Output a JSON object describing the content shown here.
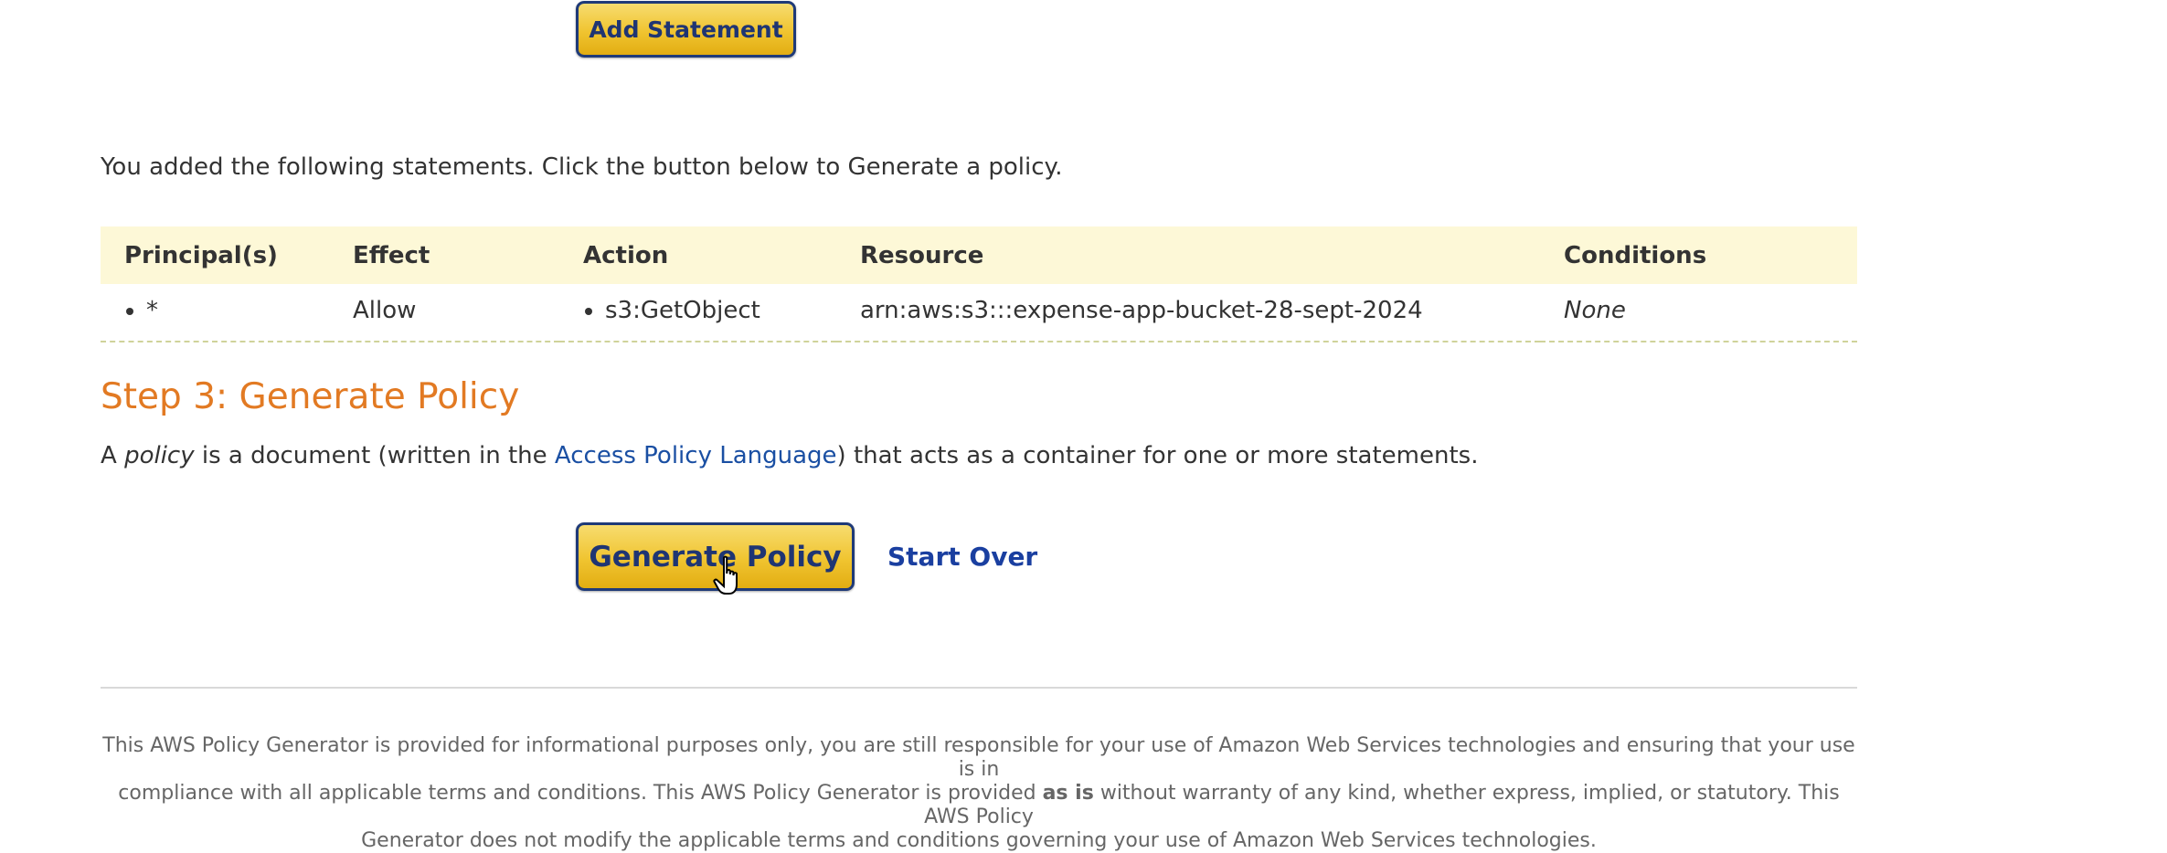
{
  "add_statement_button": "Add Statement",
  "intro_text": "You added the following statements. Click the button below to Generate a policy.",
  "statements_table": {
    "headers": [
      "Principal(s)",
      "Effect",
      "Action",
      "Resource",
      "Conditions"
    ],
    "rows": [
      {
        "principal": "*",
        "effect": "Allow",
        "action": "s3:GetObject",
        "resource": "arn:aws:s3:::expense-app-bucket-28-sept-2024",
        "conditions": "None"
      }
    ]
  },
  "step3": {
    "title": "Step 3: Generate Policy",
    "desc_prefix": "A ",
    "desc_italic": "policy",
    "desc_middle": " is a document (written in the ",
    "desc_link": "Access Policy Language",
    "desc_suffix": ") that acts as a container for one or more statements."
  },
  "generate_policy_button": "Generate Policy",
  "start_over_link": "Start Over",
  "disclaimer": {
    "line1": "This AWS Policy Generator is provided for informational purposes only, you are still responsible for your use of Amazon Web Services technologies and ensuring that your use is in",
    "line2_prefix": "compliance with all applicable terms and conditions. This AWS Policy Generator is provided ",
    "line2_bold": "as is",
    "line2_suffix": " without warranty of any kind, whether express, implied, or statutory. This AWS Policy",
    "line3": "Generator does not modify the applicable terms and conditions governing your use of Amazon Web Services technologies."
  },
  "colors": {
    "button_gold": "#f0c430",
    "button_border": "#1f3a78",
    "heading_orange": "#e27a23",
    "link_blue": "#1a4fa3",
    "table_header_bg": "#fdf8d7"
  },
  "icons": {
    "cursor": "hand-pointer-icon"
  }
}
